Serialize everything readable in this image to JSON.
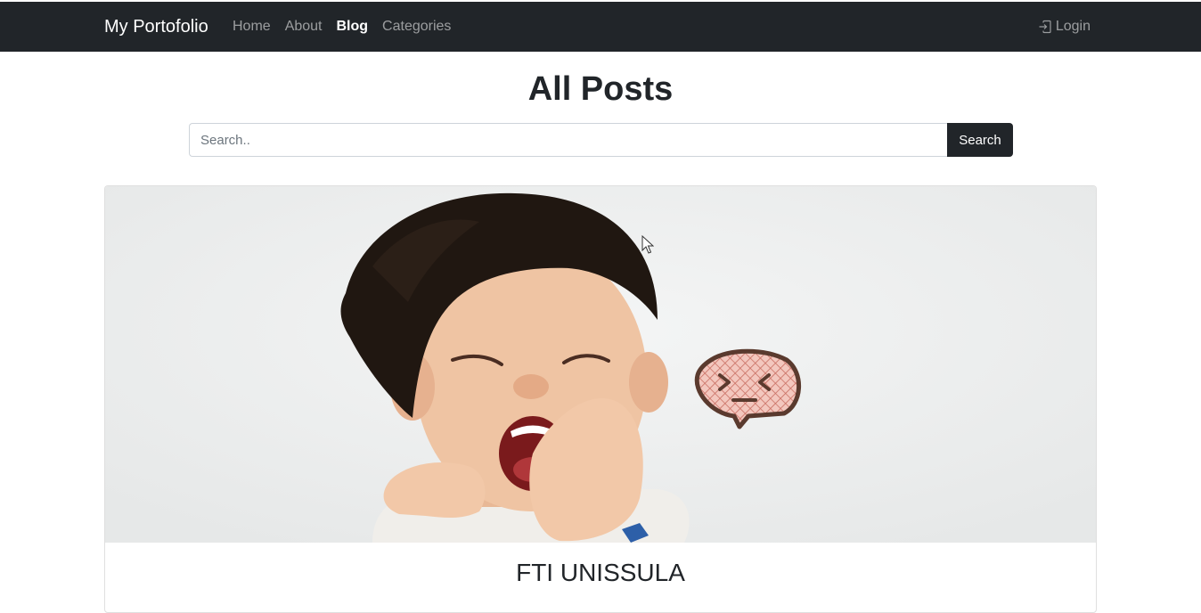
{
  "navbar": {
    "brand": "My Portofolio",
    "links": [
      {
        "label": "Home",
        "active": false
      },
      {
        "label": "About",
        "active": false
      },
      {
        "label": "Blog",
        "active": true
      },
      {
        "label": "Categories",
        "active": false
      }
    ],
    "login_label": "Login",
    "login_icon": "login-icon"
  },
  "main": {
    "title": "All Posts",
    "search": {
      "placeholder": "Search..",
      "value": "",
      "button_label": "Search"
    }
  },
  "posts": [
    {
      "title": "FTI UNISSULA",
      "image_icon": "child-yawning-photo"
    }
  ],
  "colors": {
    "navbar_bg": "#212529",
    "button_bg": "#212529",
    "text": "#212529"
  }
}
